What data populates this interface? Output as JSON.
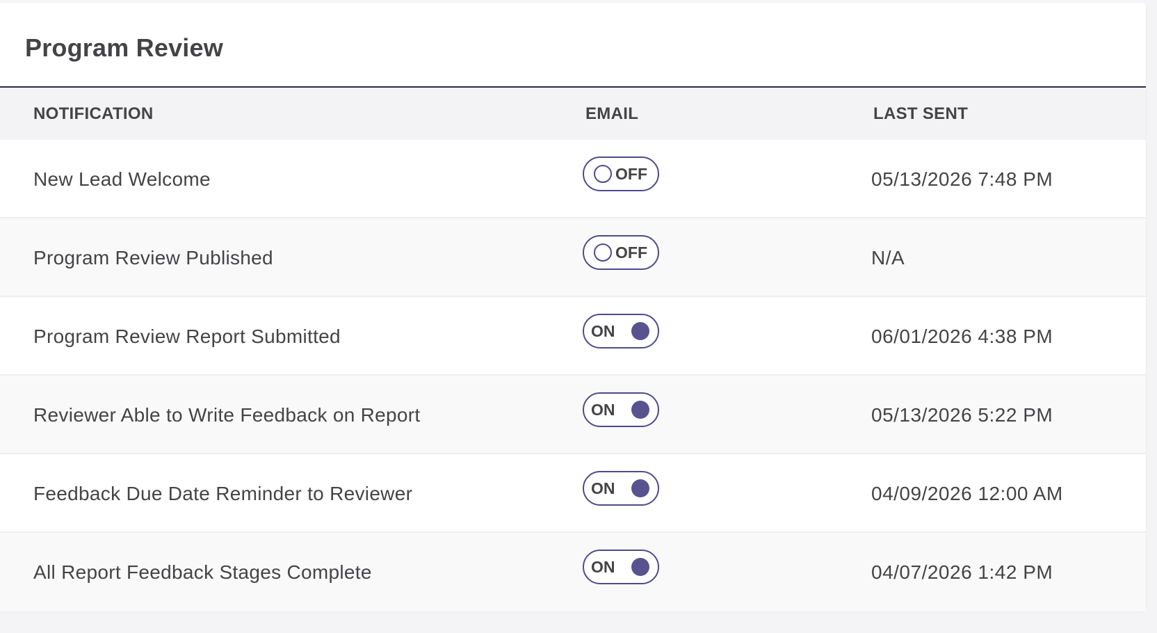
{
  "section": {
    "title": "Program Review"
  },
  "table": {
    "columns": {
      "notification": "NOTIFICATION",
      "email": "EMAIL",
      "last_sent": "LAST SENT"
    },
    "rows": [
      {
        "notification": "New Lead Welcome",
        "email_state": "off",
        "email_label": "OFF",
        "last_sent": "05/13/2026 7:48 PM"
      },
      {
        "notification": "Program Review Published",
        "email_state": "off",
        "email_label": "OFF",
        "last_sent": "N/A"
      },
      {
        "notification": "Program Review Report Submitted",
        "email_state": "on",
        "email_label": "ON",
        "last_sent": "06/01/2026 4:38 PM"
      },
      {
        "notification": "Reviewer Able to Write Feedback on Report",
        "email_state": "on",
        "email_label": "ON",
        "last_sent": "05/13/2026 5:22 PM"
      },
      {
        "notification": "Feedback Due Date Reminder to Reviewer",
        "email_state": "on",
        "email_label": "ON",
        "last_sent": "04/09/2026 12:00 AM"
      },
      {
        "notification": "All Report Feedback Stages Complete",
        "email_state": "on",
        "email_label": "ON",
        "last_sent": "04/07/2026 1:42 PM"
      }
    ]
  },
  "colors": {
    "accent": "#58538f",
    "toggle_border": "#4f4a8c",
    "header_divider": "#2c2a4a",
    "header_row_bg": "#f3f3f5",
    "alt_row_bg": "#f9f9fa",
    "text": "#444446"
  }
}
